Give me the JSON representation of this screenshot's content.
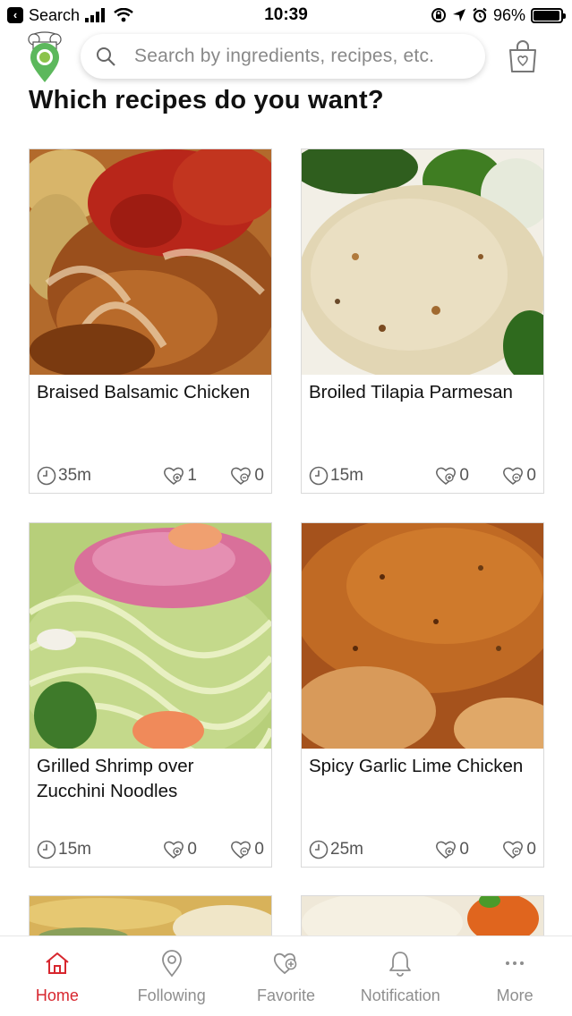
{
  "status_bar": {
    "back_label": "Search",
    "time": "10:39",
    "battery": "96%",
    "battery_level": 0.96
  },
  "search": {
    "placeholder": "Search by ingredients, recipes, etc."
  },
  "page_title": "Which recipes do you want?",
  "recipes": [
    {
      "title": "Braised Balsamic Chicken",
      "time": "35m",
      "likes": "1",
      "saves": "0"
    },
    {
      "title": "Broiled Tilapia Parmesan",
      "time": "15m",
      "likes": "0",
      "saves": "0"
    },
    {
      "title": "Grilled Shrimp over Zucchini Noodles",
      "time": "15m",
      "likes": "0",
      "saves": "0"
    },
    {
      "title": "Spicy Garlic Lime Chicken",
      "time": "25m",
      "likes": "0",
      "saves": "0"
    }
  ],
  "tabs": [
    {
      "label": "Home",
      "icon": "home-icon",
      "active": true
    },
    {
      "label": "Following",
      "icon": "location-pin-icon",
      "active": false
    },
    {
      "label": "Favorite",
      "icon": "heart-plus-icon",
      "active": false
    },
    {
      "label": "Notification",
      "icon": "bell-icon",
      "active": false
    },
    {
      "label": "More",
      "icon": "more-dots-icon",
      "active": false
    }
  ],
  "colors": {
    "accent": "#d7262e",
    "logo_green": "#4caf50",
    "tab_inactive": "#8e8e8e"
  }
}
